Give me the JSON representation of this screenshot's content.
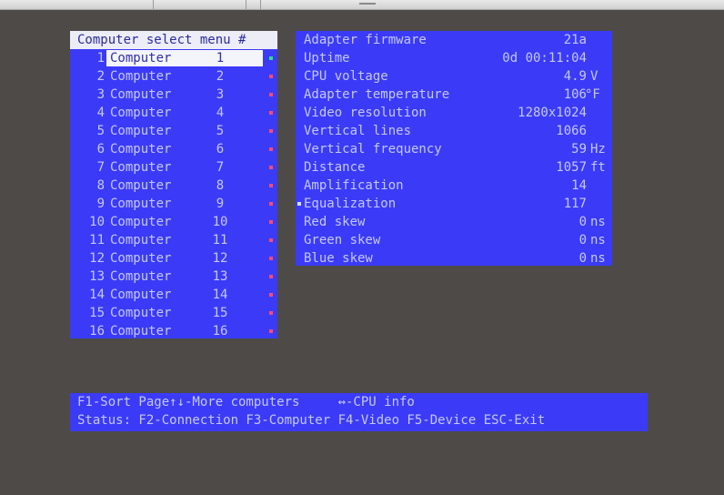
{
  "menu": {
    "header": "Computer select menu #",
    "rows": [
      {
        "num": "1",
        "name": "Computer",
        "idx": "1",
        "selected": true,
        "dot": "green"
      },
      {
        "num": "2",
        "name": "Computer",
        "idx": "2",
        "selected": false,
        "dot": "red"
      },
      {
        "num": "3",
        "name": "Computer",
        "idx": "3",
        "selected": false,
        "dot": "red"
      },
      {
        "num": "4",
        "name": "Computer",
        "idx": "4",
        "selected": false,
        "dot": "red"
      },
      {
        "num": "5",
        "name": "Computer",
        "idx": "5",
        "selected": false,
        "dot": "red"
      },
      {
        "num": "6",
        "name": "Computer",
        "idx": "6",
        "selected": false,
        "dot": "red"
      },
      {
        "num": "7",
        "name": "Computer",
        "idx": "7",
        "selected": false,
        "dot": "red"
      },
      {
        "num": "8",
        "name": "Computer",
        "idx": "8",
        "selected": false,
        "dot": "red"
      },
      {
        "num": "9",
        "name": "Computer",
        "idx": "9",
        "selected": false,
        "dot": "red"
      },
      {
        "num": "10",
        "name": "Computer",
        "idx": "10",
        "selected": false,
        "dot": "red"
      },
      {
        "num": "11",
        "name": "Computer",
        "idx": "11",
        "selected": false,
        "dot": "red"
      },
      {
        "num": "12",
        "name": "Computer",
        "idx": "12",
        "selected": false,
        "dot": "red"
      },
      {
        "num": "13",
        "name": "Computer",
        "idx": "13",
        "selected": false,
        "dot": "red"
      },
      {
        "num": "14",
        "name": "Computer",
        "idx": "14",
        "selected": false,
        "dot": "red"
      },
      {
        "num": "15",
        "name": "Computer",
        "idx": "15",
        "selected": false,
        "dot": "red"
      },
      {
        "num": "16",
        "name": "Computer",
        "idx": "16",
        "selected": false,
        "dot": "red"
      }
    ]
  },
  "info": {
    "rows": [
      {
        "label": "Adapter firmware",
        "value": "21a",
        "unit": ""
      },
      {
        "label": "Uptime",
        "value": "0d 00:11:04",
        "unit": ""
      },
      {
        "label": "CPU voltage",
        "value": "4.9",
        "unit": "V"
      },
      {
        "label": "Adapter temperature",
        "value": "106",
        "unit": "°F"
      },
      {
        "label": "Video resolution",
        "value": "1280x1024",
        "unit": ""
      },
      {
        "label": "Vertical lines",
        "value": "1066",
        "unit": ""
      },
      {
        "label": "Vertical frequency",
        "value": "59",
        "unit": "Hz"
      },
      {
        "label": "Distance",
        "value": "1057",
        "unit": "ft"
      },
      {
        "label": "Amplification",
        "value": "14",
        "unit": ""
      },
      {
        "label": "Equalization",
        "value": "117",
        "unit": "",
        "marked": true
      },
      {
        "label": "Red skew",
        "value": "0",
        "unit": "ns"
      },
      {
        "label": "Green skew",
        "value": "0",
        "unit": "ns"
      },
      {
        "label": "Blue skew",
        "value": "0",
        "unit": "ns"
      }
    ]
  },
  "status": {
    "line1": "F1-Sort Page↑↓-More computers     ↔-CPU info",
    "line2": "Status: F2-Connection F3-Computer F4-Video F5-Device ESC-Exit"
  },
  "colors": {
    "background": "#4d4a48",
    "panel": "#3b3bf7",
    "text": "#c4c8ff",
    "highlight": "#f4f4fb",
    "dot_green": "#2ee07a",
    "dot_red": "#ff4a6e"
  }
}
